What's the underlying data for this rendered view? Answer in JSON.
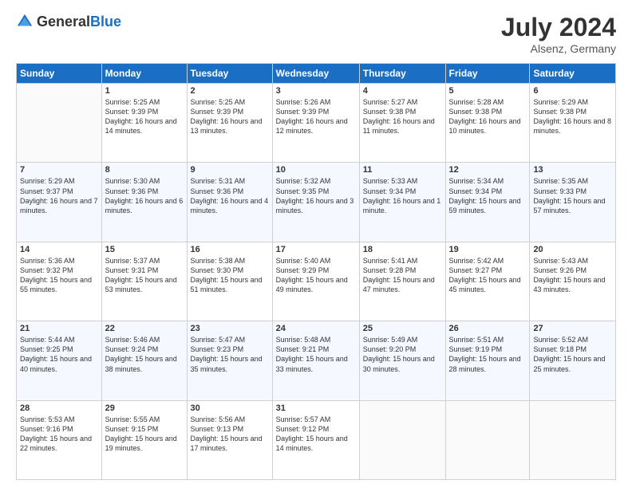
{
  "header": {
    "logo": {
      "general": "General",
      "blue": "Blue"
    },
    "title": "July 2024",
    "location": "Alsenz, Germany"
  },
  "calendar": {
    "columns": [
      "Sunday",
      "Monday",
      "Tuesday",
      "Wednesday",
      "Thursday",
      "Friday",
      "Saturday"
    ],
    "weeks": [
      [
        {
          "day": "",
          "sunrise": "",
          "sunset": "",
          "daylight": ""
        },
        {
          "day": "1",
          "sunrise": "Sunrise: 5:25 AM",
          "sunset": "Sunset: 9:39 PM",
          "daylight": "Daylight: 16 hours and 14 minutes."
        },
        {
          "day": "2",
          "sunrise": "Sunrise: 5:25 AM",
          "sunset": "Sunset: 9:39 PM",
          "daylight": "Daylight: 16 hours and 13 minutes."
        },
        {
          "day": "3",
          "sunrise": "Sunrise: 5:26 AM",
          "sunset": "Sunset: 9:39 PM",
          "daylight": "Daylight: 16 hours and 12 minutes."
        },
        {
          "day": "4",
          "sunrise": "Sunrise: 5:27 AM",
          "sunset": "Sunset: 9:38 PM",
          "daylight": "Daylight: 16 hours and 11 minutes."
        },
        {
          "day": "5",
          "sunrise": "Sunrise: 5:28 AM",
          "sunset": "Sunset: 9:38 PM",
          "daylight": "Daylight: 16 hours and 10 minutes."
        },
        {
          "day": "6",
          "sunrise": "Sunrise: 5:29 AM",
          "sunset": "Sunset: 9:38 PM",
          "daylight": "Daylight: 16 hours and 8 minutes."
        }
      ],
      [
        {
          "day": "7",
          "sunrise": "Sunrise: 5:29 AM",
          "sunset": "Sunset: 9:37 PM",
          "daylight": "Daylight: 16 hours and 7 minutes."
        },
        {
          "day": "8",
          "sunrise": "Sunrise: 5:30 AM",
          "sunset": "Sunset: 9:36 PM",
          "daylight": "Daylight: 16 hours and 6 minutes."
        },
        {
          "day": "9",
          "sunrise": "Sunrise: 5:31 AM",
          "sunset": "Sunset: 9:36 PM",
          "daylight": "Daylight: 16 hours and 4 minutes."
        },
        {
          "day": "10",
          "sunrise": "Sunrise: 5:32 AM",
          "sunset": "Sunset: 9:35 PM",
          "daylight": "Daylight: 16 hours and 3 minutes."
        },
        {
          "day": "11",
          "sunrise": "Sunrise: 5:33 AM",
          "sunset": "Sunset: 9:34 PM",
          "daylight": "Daylight: 16 hours and 1 minute."
        },
        {
          "day": "12",
          "sunrise": "Sunrise: 5:34 AM",
          "sunset": "Sunset: 9:34 PM",
          "daylight": "Daylight: 15 hours and 59 minutes."
        },
        {
          "day": "13",
          "sunrise": "Sunrise: 5:35 AM",
          "sunset": "Sunset: 9:33 PM",
          "daylight": "Daylight: 15 hours and 57 minutes."
        }
      ],
      [
        {
          "day": "14",
          "sunrise": "Sunrise: 5:36 AM",
          "sunset": "Sunset: 9:32 PM",
          "daylight": "Daylight: 15 hours and 55 minutes."
        },
        {
          "day": "15",
          "sunrise": "Sunrise: 5:37 AM",
          "sunset": "Sunset: 9:31 PM",
          "daylight": "Daylight: 15 hours and 53 minutes."
        },
        {
          "day": "16",
          "sunrise": "Sunrise: 5:38 AM",
          "sunset": "Sunset: 9:30 PM",
          "daylight": "Daylight: 15 hours and 51 minutes."
        },
        {
          "day": "17",
          "sunrise": "Sunrise: 5:40 AM",
          "sunset": "Sunset: 9:29 PM",
          "daylight": "Daylight: 15 hours and 49 minutes."
        },
        {
          "day": "18",
          "sunrise": "Sunrise: 5:41 AM",
          "sunset": "Sunset: 9:28 PM",
          "daylight": "Daylight: 15 hours and 47 minutes."
        },
        {
          "day": "19",
          "sunrise": "Sunrise: 5:42 AM",
          "sunset": "Sunset: 9:27 PM",
          "daylight": "Daylight: 15 hours and 45 minutes."
        },
        {
          "day": "20",
          "sunrise": "Sunrise: 5:43 AM",
          "sunset": "Sunset: 9:26 PM",
          "daylight": "Daylight: 15 hours and 43 minutes."
        }
      ],
      [
        {
          "day": "21",
          "sunrise": "Sunrise: 5:44 AM",
          "sunset": "Sunset: 9:25 PM",
          "daylight": "Daylight: 15 hours and 40 minutes."
        },
        {
          "day": "22",
          "sunrise": "Sunrise: 5:46 AM",
          "sunset": "Sunset: 9:24 PM",
          "daylight": "Daylight: 15 hours and 38 minutes."
        },
        {
          "day": "23",
          "sunrise": "Sunrise: 5:47 AM",
          "sunset": "Sunset: 9:23 PM",
          "daylight": "Daylight: 15 hours and 35 minutes."
        },
        {
          "day": "24",
          "sunrise": "Sunrise: 5:48 AM",
          "sunset": "Sunset: 9:21 PM",
          "daylight": "Daylight: 15 hours and 33 minutes."
        },
        {
          "day": "25",
          "sunrise": "Sunrise: 5:49 AM",
          "sunset": "Sunset: 9:20 PM",
          "daylight": "Daylight: 15 hours and 30 minutes."
        },
        {
          "day": "26",
          "sunrise": "Sunrise: 5:51 AM",
          "sunset": "Sunset: 9:19 PM",
          "daylight": "Daylight: 15 hours and 28 minutes."
        },
        {
          "day": "27",
          "sunrise": "Sunrise: 5:52 AM",
          "sunset": "Sunset: 9:18 PM",
          "daylight": "Daylight: 15 hours and 25 minutes."
        }
      ],
      [
        {
          "day": "28",
          "sunrise": "Sunrise: 5:53 AM",
          "sunset": "Sunset: 9:16 PM",
          "daylight": "Daylight: 15 hours and 22 minutes."
        },
        {
          "day": "29",
          "sunrise": "Sunrise: 5:55 AM",
          "sunset": "Sunset: 9:15 PM",
          "daylight": "Daylight: 15 hours and 19 minutes."
        },
        {
          "day": "30",
          "sunrise": "Sunrise: 5:56 AM",
          "sunset": "Sunset: 9:13 PM",
          "daylight": "Daylight: 15 hours and 17 minutes."
        },
        {
          "day": "31",
          "sunrise": "Sunrise: 5:57 AM",
          "sunset": "Sunset: 9:12 PM",
          "daylight": "Daylight: 15 hours and 14 minutes."
        },
        {
          "day": "",
          "sunrise": "",
          "sunset": "",
          "daylight": ""
        },
        {
          "day": "",
          "sunrise": "",
          "sunset": "",
          "daylight": ""
        },
        {
          "day": "",
          "sunrise": "",
          "sunset": "",
          "daylight": ""
        }
      ]
    ]
  }
}
